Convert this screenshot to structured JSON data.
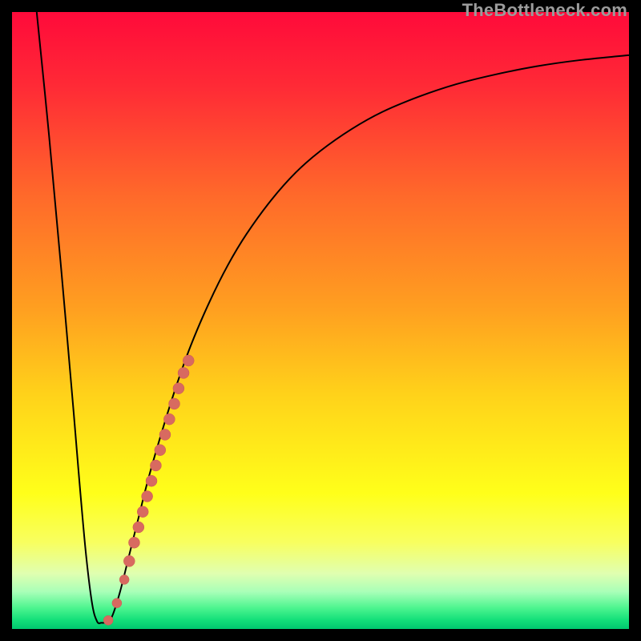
{
  "watermark": "TheBottleneck.com",
  "colors": {
    "gradient_stops": [
      {
        "offset": 0.0,
        "color": "#ff0a3a"
      },
      {
        "offset": 0.12,
        "color": "#ff2a36"
      },
      {
        "offset": 0.3,
        "color": "#ff6a2a"
      },
      {
        "offset": 0.48,
        "color": "#ff9f20"
      },
      {
        "offset": 0.62,
        "color": "#ffd21a"
      },
      {
        "offset": 0.78,
        "color": "#ffff1a"
      },
      {
        "offset": 0.86,
        "color": "#f8ff60"
      },
      {
        "offset": 0.91,
        "color": "#e0ffb0"
      },
      {
        "offset": 0.94,
        "color": "#a8ffb8"
      },
      {
        "offset": 0.965,
        "color": "#50f590"
      },
      {
        "offset": 0.985,
        "color": "#14e07a"
      },
      {
        "offset": 1.0,
        "color": "#00c86f"
      }
    ],
    "curve": "#000000",
    "dot_fill": "#d86a60",
    "dot_stroke": "#cc5a50"
  },
  "chart_data": {
    "type": "line",
    "title": "",
    "xlabel": "",
    "ylabel": "",
    "xlim": [
      0,
      100
    ],
    "ylim": [
      0,
      100
    ],
    "series": [
      {
        "name": "bottleneck-curve",
        "x": [
          4.0,
          6.0,
          8.0,
          10.0,
          11.0,
          12.0,
          13.0,
          13.8,
          14.5,
          15.3,
          16.2,
          17.5,
          19.0,
          20.5,
          22.0,
          24.0,
          26.5,
          29.0,
          32.0,
          35.0,
          38.0,
          42.0,
          46.0,
          50.0,
          55.0,
          60.0,
          66.0,
          72.0,
          78.0,
          85.0,
          92.0,
          100.0
        ],
        "y": [
          100.0,
          80.0,
          58.0,
          35.0,
          23.0,
          12.0,
          4.0,
          1.2,
          1.0,
          1.1,
          2.0,
          6.0,
          12.0,
          18.0,
          24.0,
          31.0,
          39.0,
          46.0,
          53.0,
          59.0,
          64.0,
          69.5,
          74.0,
          77.5,
          81.0,
          83.8,
          86.3,
          88.3,
          89.8,
          91.2,
          92.2,
          93.0
        ]
      }
    ],
    "dots": [
      {
        "x": 15.6,
        "y": 1.4,
        "r": 6
      },
      {
        "x": 17.0,
        "y": 4.2,
        "r": 6
      },
      {
        "x": 18.2,
        "y": 8.0,
        "r": 6
      },
      {
        "x": 19.0,
        "y": 11.0,
        "r": 7
      },
      {
        "x": 19.8,
        "y": 14.0,
        "r": 7
      },
      {
        "x": 20.5,
        "y": 16.5,
        "r": 7
      },
      {
        "x": 21.2,
        "y": 19.0,
        "r": 7
      },
      {
        "x": 21.9,
        "y": 21.5,
        "r": 7
      },
      {
        "x": 22.6,
        "y": 24.0,
        "r": 7
      },
      {
        "x": 23.3,
        "y": 26.5,
        "r": 7
      },
      {
        "x": 24.0,
        "y": 29.0,
        "r": 7
      },
      {
        "x": 24.8,
        "y": 31.5,
        "r": 7
      },
      {
        "x": 25.5,
        "y": 34.0,
        "r": 7
      },
      {
        "x": 26.3,
        "y": 36.5,
        "r": 7
      },
      {
        "x": 27.0,
        "y": 39.0,
        "r": 7
      },
      {
        "x": 27.8,
        "y": 41.5,
        "r": 7
      },
      {
        "x": 28.6,
        "y": 43.5,
        "r": 7
      }
    ]
  }
}
